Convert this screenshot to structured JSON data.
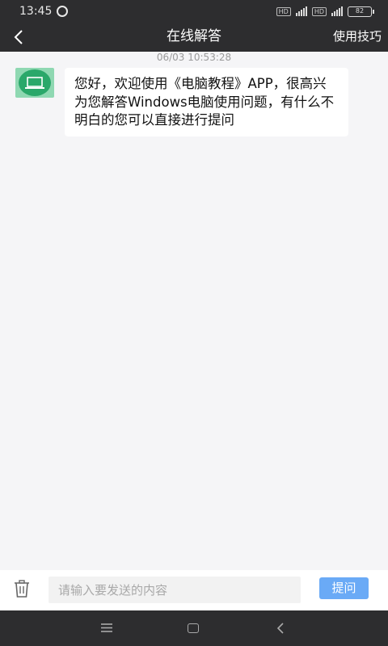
{
  "status_bar": {
    "time": "13:45",
    "battery": "82"
  },
  "nav": {
    "title": "在线解答",
    "right_label": "使用技巧",
    "back_icon": "back-arrow-icon"
  },
  "chat": {
    "timestamp": "06/03 10:53:28",
    "messages": [
      {
        "sender_icon": "laptop-icon",
        "text": "您好，欢迎使用《电脑教程》APP，很高兴为您解答Windows电脑使用问题，有什么不明白的您可以直接进行提问"
      }
    ]
  },
  "composer": {
    "placeholder": "请输入要发送的内容",
    "value": "",
    "send_label": "提问"
  },
  "colors": {
    "accent": "#6aaaf6",
    "bar": "#2d2d2f",
    "avatar_bg": "#2aa86a"
  }
}
